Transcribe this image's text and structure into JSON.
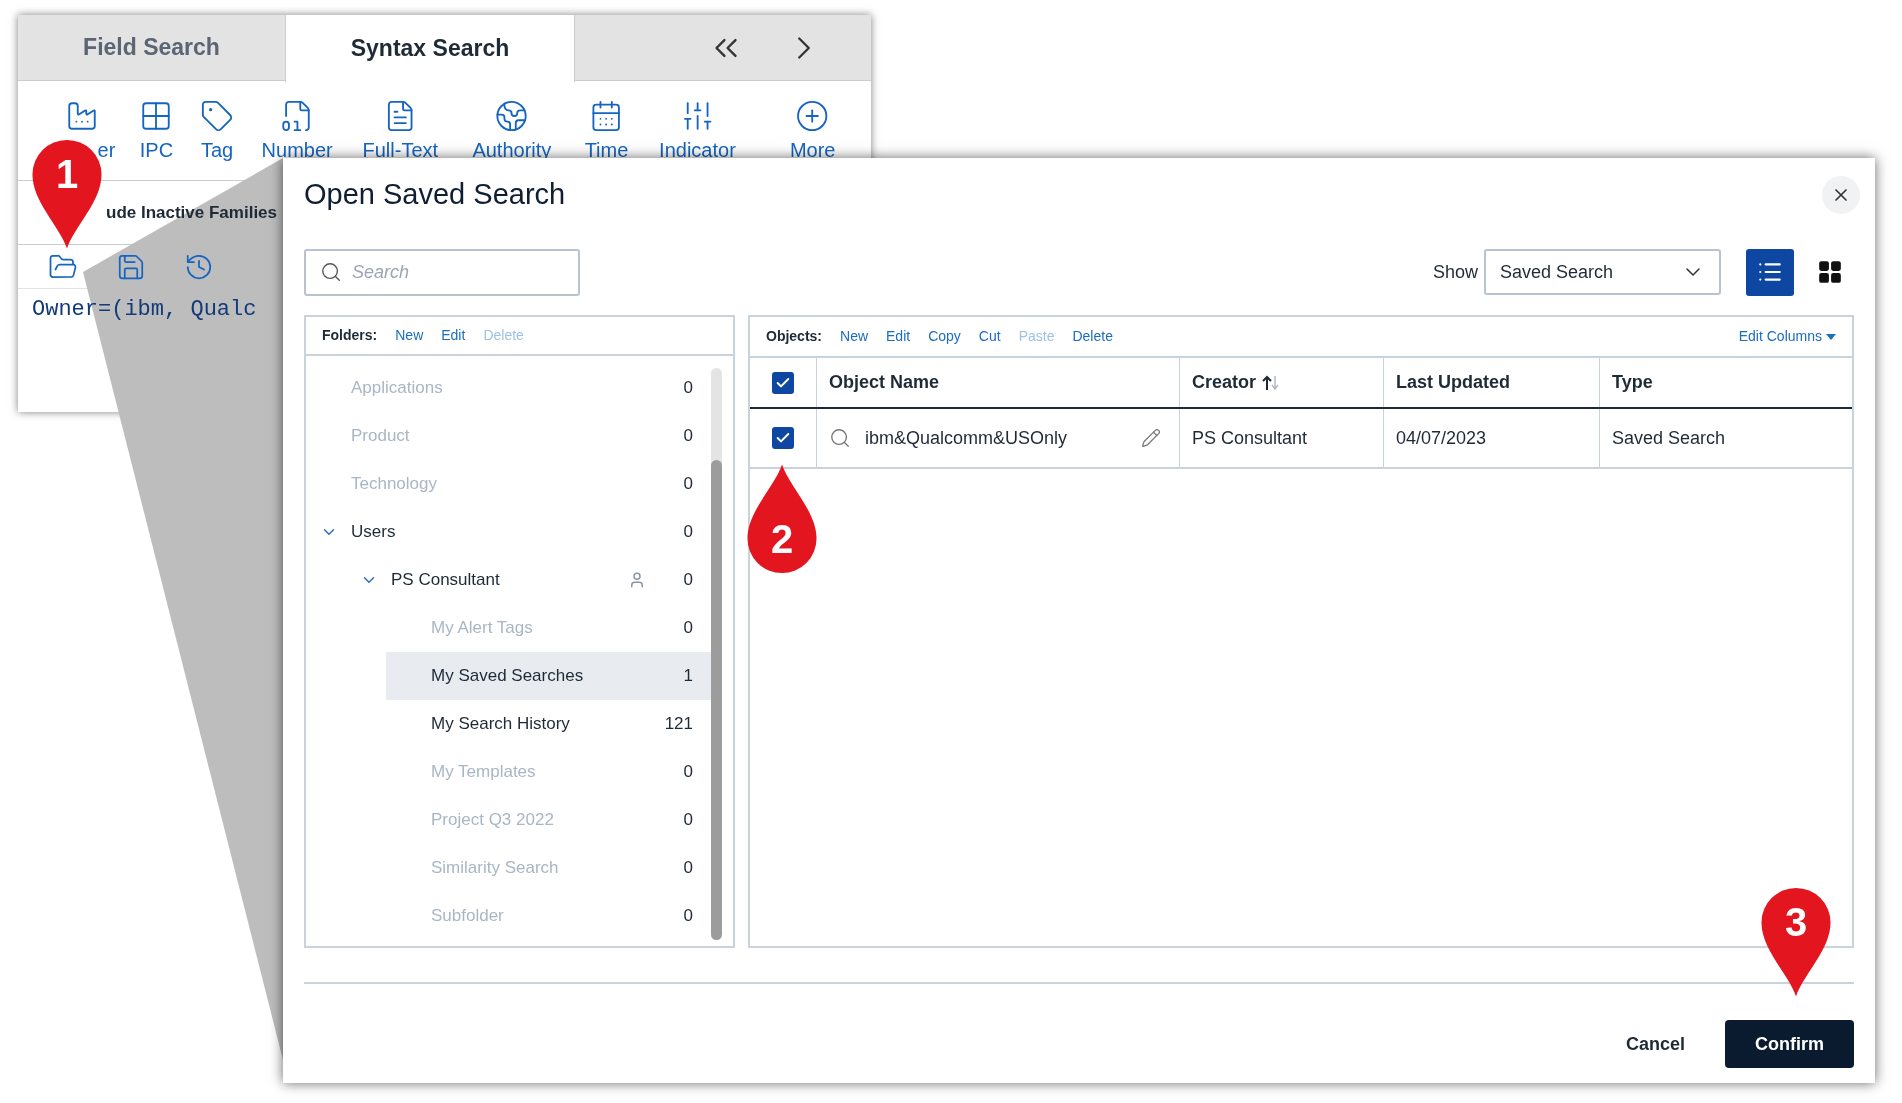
{
  "back_panel": {
    "tabs": [
      {
        "label": "Field Search",
        "selected": false
      },
      {
        "label": "Syntax Search",
        "selected": true
      }
    ],
    "tools": [
      {
        "kind": "factory",
        "label": "er"
      },
      {
        "kind": "grid",
        "label": "IPC"
      },
      {
        "kind": "tag",
        "label": "Tag"
      },
      {
        "kind": "number",
        "label": "Number"
      },
      {
        "kind": "document",
        "label": "Full-Text"
      },
      {
        "kind": "globe",
        "label": "Authority"
      },
      {
        "kind": "calendar",
        "label": "Time"
      },
      {
        "kind": "sliders",
        "label": "Indicator"
      },
      {
        "kind": "plus",
        "label": "More"
      }
    ],
    "option_label": "ude Inactive Families",
    "query": "Owner=(ibm, Qualc"
  },
  "dialog": {
    "title": "Open Saved Search",
    "search": {
      "placeholder": "Search"
    },
    "show_label": "Show",
    "show_value": "Saved Search",
    "views": [
      {
        "kind": "list",
        "selected": true
      },
      {
        "kind": "grid",
        "selected": false
      }
    ],
    "folders": {
      "label": "Folders:",
      "actions": [
        {
          "label": "New",
          "disabled": false
        },
        {
          "label": "Edit",
          "disabled": false
        },
        {
          "label": "Delete",
          "disabled": true
        }
      ],
      "tree": [
        {
          "name": "Applications",
          "count": "0",
          "dimmed": true,
          "selected": false
        },
        {
          "name": "Product",
          "count": "0",
          "dimmed": true,
          "selected": false
        },
        {
          "name": "Technology",
          "count": "0",
          "dimmed": true,
          "selected": false
        },
        {
          "name": "Users",
          "count": "0",
          "dimmed": false,
          "selected": false,
          "expanded": true,
          "children": [
            {
              "name": "PS Consultant",
              "count": "0",
              "dimmed": false,
              "selected": false,
              "expanded": true,
              "owner": true,
              "children": [
                {
                  "name": "My Alert Tags",
                  "count": "0",
                  "dimmed": true,
                  "selected": false
                },
                {
                  "name": "My Saved Searches",
                  "count": "1",
                  "dimmed": false,
                  "selected": true
                },
                {
                  "name": "My Search History",
                  "count": "121",
                  "dimmed": false,
                  "selected": false
                },
                {
                  "name": "My Templates",
                  "count": "0",
                  "dimmed": true,
                  "selected": false
                },
                {
                  "name": "Project Q3 2022",
                  "count": "0",
                  "dimmed": true,
                  "selected": false
                },
                {
                  "name": "Similarity Search",
                  "count": "0",
                  "dimmed": true,
                  "selected": false
                },
                {
                  "name": "Subfolder",
                  "count": "0",
                  "dimmed": true,
                  "selected": false
                }
              ]
            }
          ]
        }
      ]
    },
    "objects": {
      "label": "Objects:",
      "actions": [
        {
          "label": "New",
          "disabled": false
        },
        {
          "label": "Edit",
          "disabled": false
        },
        {
          "label": "Copy",
          "disabled": false
        },
        {
          "label": "Cut",
          "disabled": false
        },
        {
          "label": "Paste",
          "disabled": true
        },
        {
          "label": "Delete",
          "disabled": false
        }
      ],
      "edit_columns": "Edit Columns",
      "select_all": {
        "checked": true
      },
      "columns": [
        {
          "label": "Object Name",
          "sorted": false
        },
        {
          "label": "Creator",
          "sorted": true
        },
        {
          "label": "Last Updated",
          "sorted": false
        },
        {
          "label": "Type",
          "sorted": false
        }
      ],
      "rows": [
        {
          "checked": true,
          "name": "ibm&Qualcomm&USOnly",
          "creator": "PS Consultant",
          "updated": "04/07/2023",
          "type": "Saved Search"
        }
      ]
    },
    "buttons": [
      {
        "label": "Cancel",
        "kind": "secondary"
      },
      {
        "label": "Confirm",
        "kind": "primary"
      }
    ]
  },
  "callouts": [
    {
      "label": "1",
      "kind": "down"
    },
    {
      "label": "2",
      "kind": "up"
    },
    {
      "label": "3",
      "kind": "down"
    }
  ]
}
